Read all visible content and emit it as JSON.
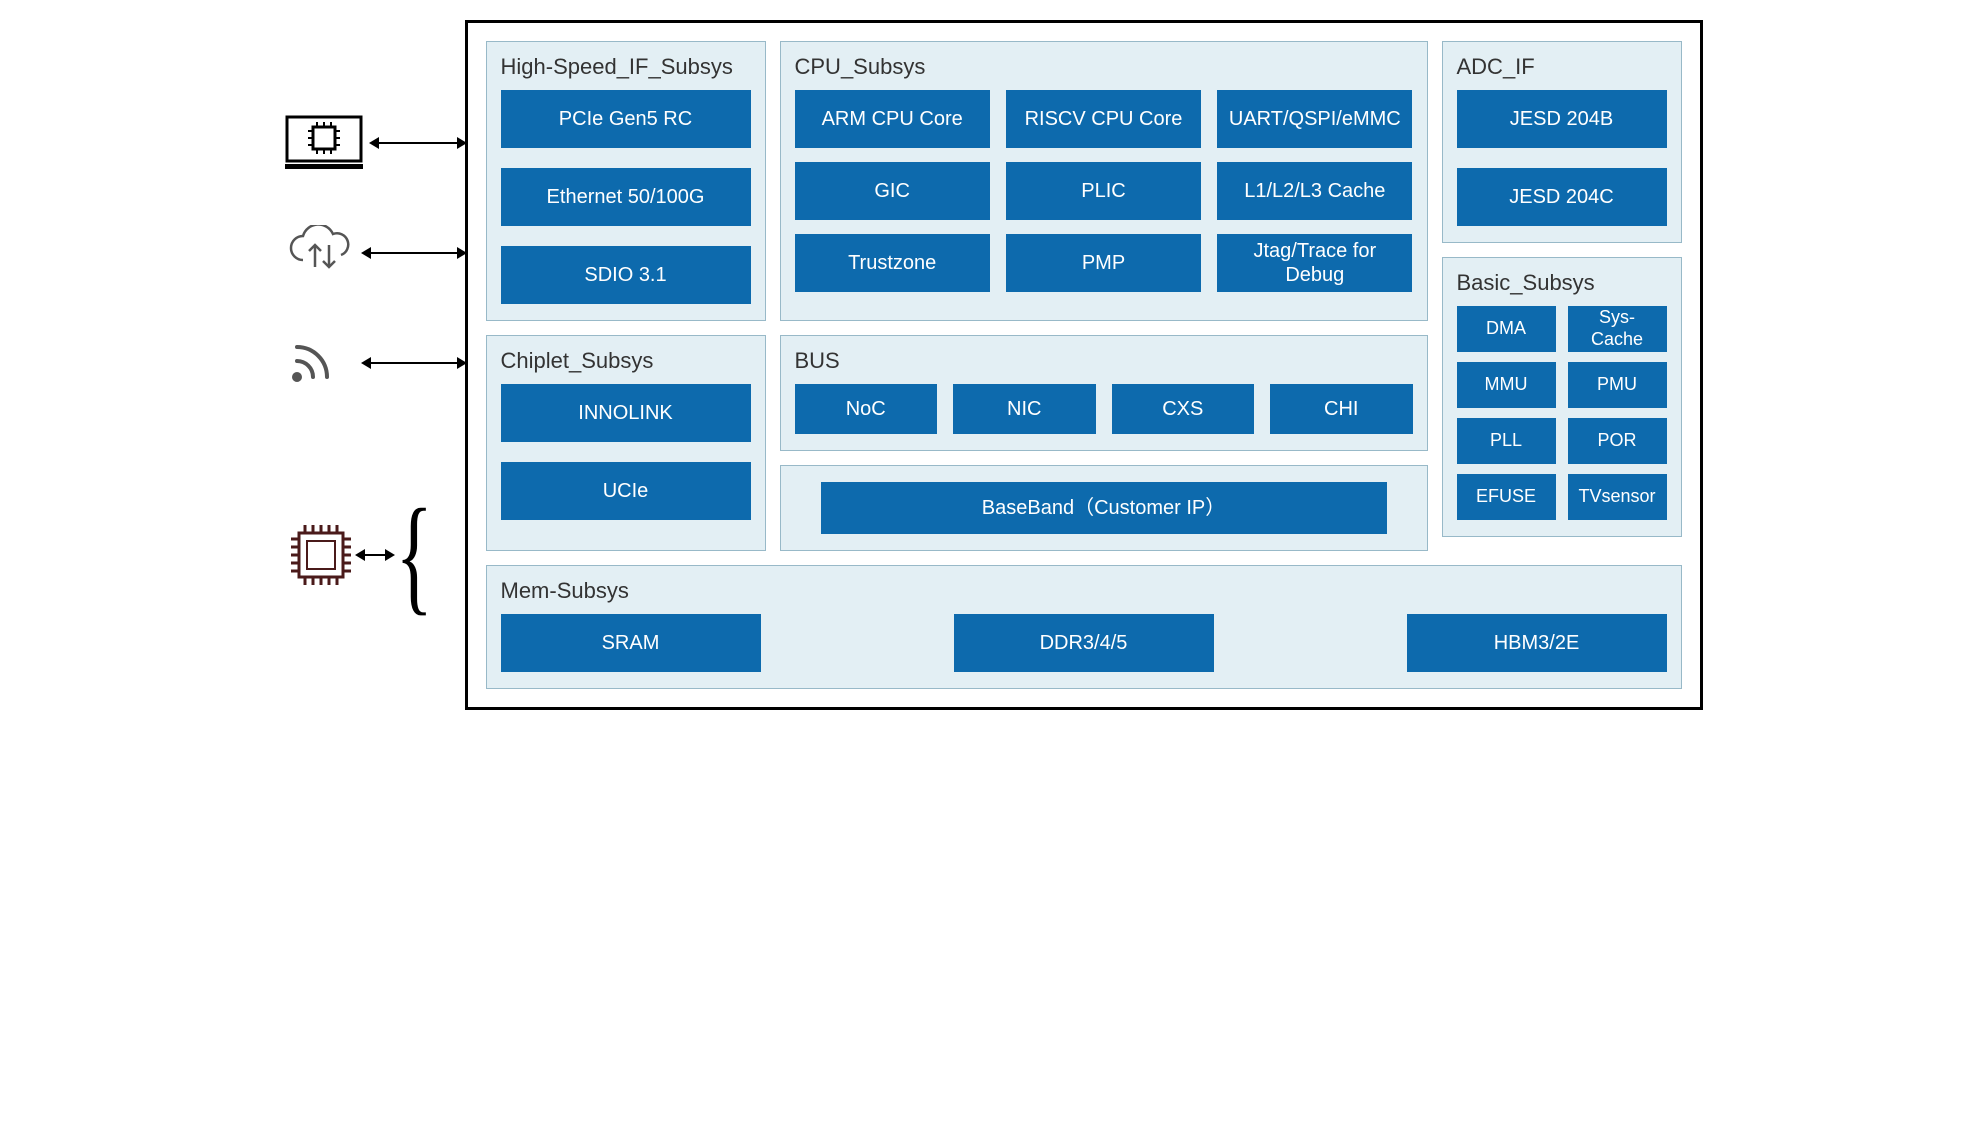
{
  "subsystems": {
    "highspeed": {
      "title": "High-Speed_IF_Subsys",
      "blocks": [
        "PCIe Gen5 RC",
        "Ethernet 50/100G",
        "SDIO 3.1"
      ]
    },
    "cpu": {
      "title": "CPU_Subsys",
      "blocks": [
        "ARM CPU Core",
        "RISCV CPU Core",
        "UART/QSPI/eMMC",
        "GIC",
        "PLIC",
        "L1/L2/L3 Cache",
        "Trustzone",
        "PMP",
        "Jtag/Trace for Debug"
      ]
    },
    "adc": {
      "title": "ADC_IF",
      "blocks": [
        "JESD 204B",
        "JESD 204C"
      ]
    },
    "chiplet": {
      "title": "Chiplet_Subsys",
      "blocks": [
        "INNOLINK",
        "UCIe"
      ]
    },
    "bus": {
      "title": "BUS",
      "blocks": [
        "NoC",
        "NIC",
        "CXS",
        "CHI"
      ]
    },
    "baseband": {
      "label": "BaseBand（Customer IP）"
    },
    "basic": {
      "title": "Basic_Subsys",
      "blocks": [
        "DMA",
        "Sys-Cache",
        "MMU",
        "PMU",
        "PLL",
        "POR",
        "EFUSE",
        "TVsensor"
      ]
    },
    "mem": {
      "title": "Mem-Subsys",
      "blocks": [
        "SRAM",
        "DDR3/4/5",
        "HBM3/2E"
      ]
    }
  },
  "colors": {
    "block_bg": "#0d6aad",
    "block_fg": "#ffffff",
    "panel_bg": "#e3eff4",
    "panel_border": "#98b9c8"
  }
}
